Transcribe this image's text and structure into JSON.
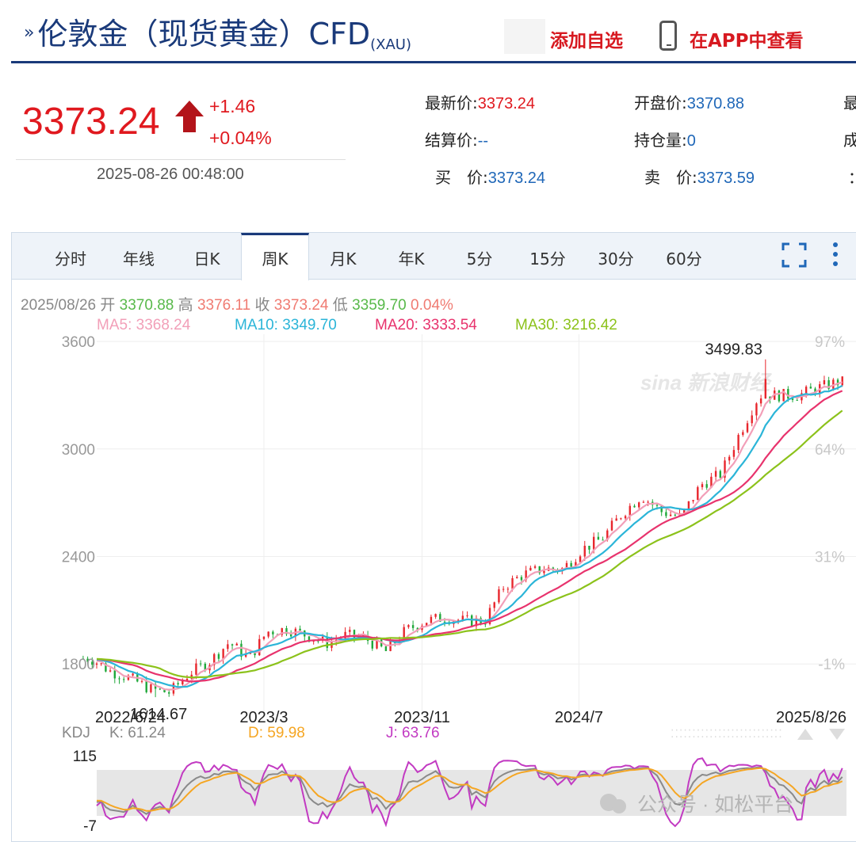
{
  "header": {
    "title": "伦敦金（现货黄金）CFD",
    "code": "(XAU)",
    "add_watch": "添加自选",
    "open_app": "在APP中查看"
  },
  "quote": {
    "price": "3373.24",
    "change": "+1.46",
    "change_pct": "+0.04%",
    "timestamp": "2025-08-26 00:48:00",
    "fields": [
      {
        "label": "最新价:",
        "value": "3373.24"
      },
      {
        "label": "开盘价:",
        "value": "3370.88"
      },
      {
        "label": "结算价:",
        "value": "--"
      },
      {
        "label": "持仓量:",
        "value": "0"
      },
      {
        "label": "买　价:",
        "value": "3373.24"
      },
      {
        "label": "卖　价:",
        "value": "3373.59"
      }
    ],
    "cut_labels": [
      "最",
      "成",
      "："
    ]
  },
  "tabs": [
    "分时",
    "年线",
    "日K",
    "周K",
    "月K",
    "年K",
    "5分",
    "15分",
    "30分",
    "60分"
  ],
  "active_tab": "周K",
  "ohlc": {
    "date": "2025/08/26",
    "open_label": "开",
    "open": "3370.88",
    "high_label": "高",
    "high": "3376.11",
    "close_label": "收",
    "close": "3373.24",
    "low_label": "低",
    "low": "3359.70",
    "pct": "0.04%"
  },
  "ma": [
    {
      "label": "MA5: 3368.24",
      "color": "#f29fb8"
    },
    {
      "label": "MA10: 3349.70",
      "color": "#2bb5d8"
    },
    {
      "label": "MA20: 3333.54",
      "color": "#e8336d"
    },
    {
      "label": "MA30: 3216.42",
      "color": "#8cc21b"
    }
  ],
  "colors": {
    "up": "#e8262d",
    "down": "#1fa83a",
    "accent": "#1a3a7a"
  },
  "watermark": {
    "sina": "sina 新浪财经",
    "wechat": "公众号 · 如松平台"
  },
  "kdj": {
    "label": "KDJ",
    "k": "K: 61.24",
    "d": "D: 59.98",
    "j": "J: 63.76",
    "ymax": "115",
    "ymin": "-7"
  },
  "chart_data": {
    "type": "candlestick",
    "title": "",
    "y_ticks": [
      "3600",
      "3000",
      "2400",
      "1800"
    ],
    "pct_ticks": [
      "97%",
      "64%",
      "31%",
      "-1%"
    ],
    "x_ticks": [
      "2022/6/24",
      "2023/3",
      "2023/11",
      "2024/7",
      "2025/8/26"
    ],
    "annotations": [
      {
        "label": "3499.83",
        "x": "2025/4",
        "y": 3499.83
      },
      {
        "label": "1614.67",
        "x": "2022/9",
        "y": 1614.67
      }
    ],
    "ylim": [
      1580,
      3640
    ],
    "close_path": [
      [
        "2022-06",
        1830
      ],
      [
        "2022-07",
        1760
      ],
      [
        "2022-08",
        1720
      ],
      [
        "2022-09",
        1660
      ],
      [
        "2022-10",
        1640
      ],
      [
        "2022-11",
        1750
      ],
      [
        "2022-12",
        1810
      ],
      [
        "2023-01",
        1920
      ],
      [
        "2023-02",
        1830
      ],
      [
        "2023-03",
        1980
      ],
      [
        "2023-04",
        1995
      ],
      [
        "2023-05",
        1960
      ],
      [
        "2023-06",
        1915
      ],
      [
        "2023-07",
        1960
      ],
      [
        "2023-08",
        1940
      ],
      [
        "2023-09",
        1870
      ],
      [
        "2023-10",
        1985
      ],
      [
        "2023-11",
        2040
      ],
      [
        "2023-12",
        2060
      ],
      [
        "2024-01",
        2040
      ],
      [
        "2024-02",
        2040
      ],
      [
        "2024-03",
        2230
      ],
      [
        "2024-04",
        2300
      ],
      [
        "2024-05",
        2330
      ],
      [
        "2024-06",
        2330
      ],
      [
        "2024-07",
        2440
      ],
      [
        "2024-08",
        2500
      ],
      [
        "2024-09",
        2640
      ],
      [
        "2024-10",
        2740
      ],
      [
        "2024-11",
        2650
      ],
      [
        "2024-12",
        2620
      ],
      [
        "2025-01",
        2800
      ],
      [
        "2025-02",
        2860
      ],
      [
        "2025-03",
        3080
      ],
      [
        "2025-04",
        3300
      ],
      [
        "2025-05",
        3300
      ],
      [
        "2025-06",
        3300
      ],
      [
        "2025-07",
        3340
      ],
      [
        "2025-08",
        3373.24
      ]
    ]
  }
}
